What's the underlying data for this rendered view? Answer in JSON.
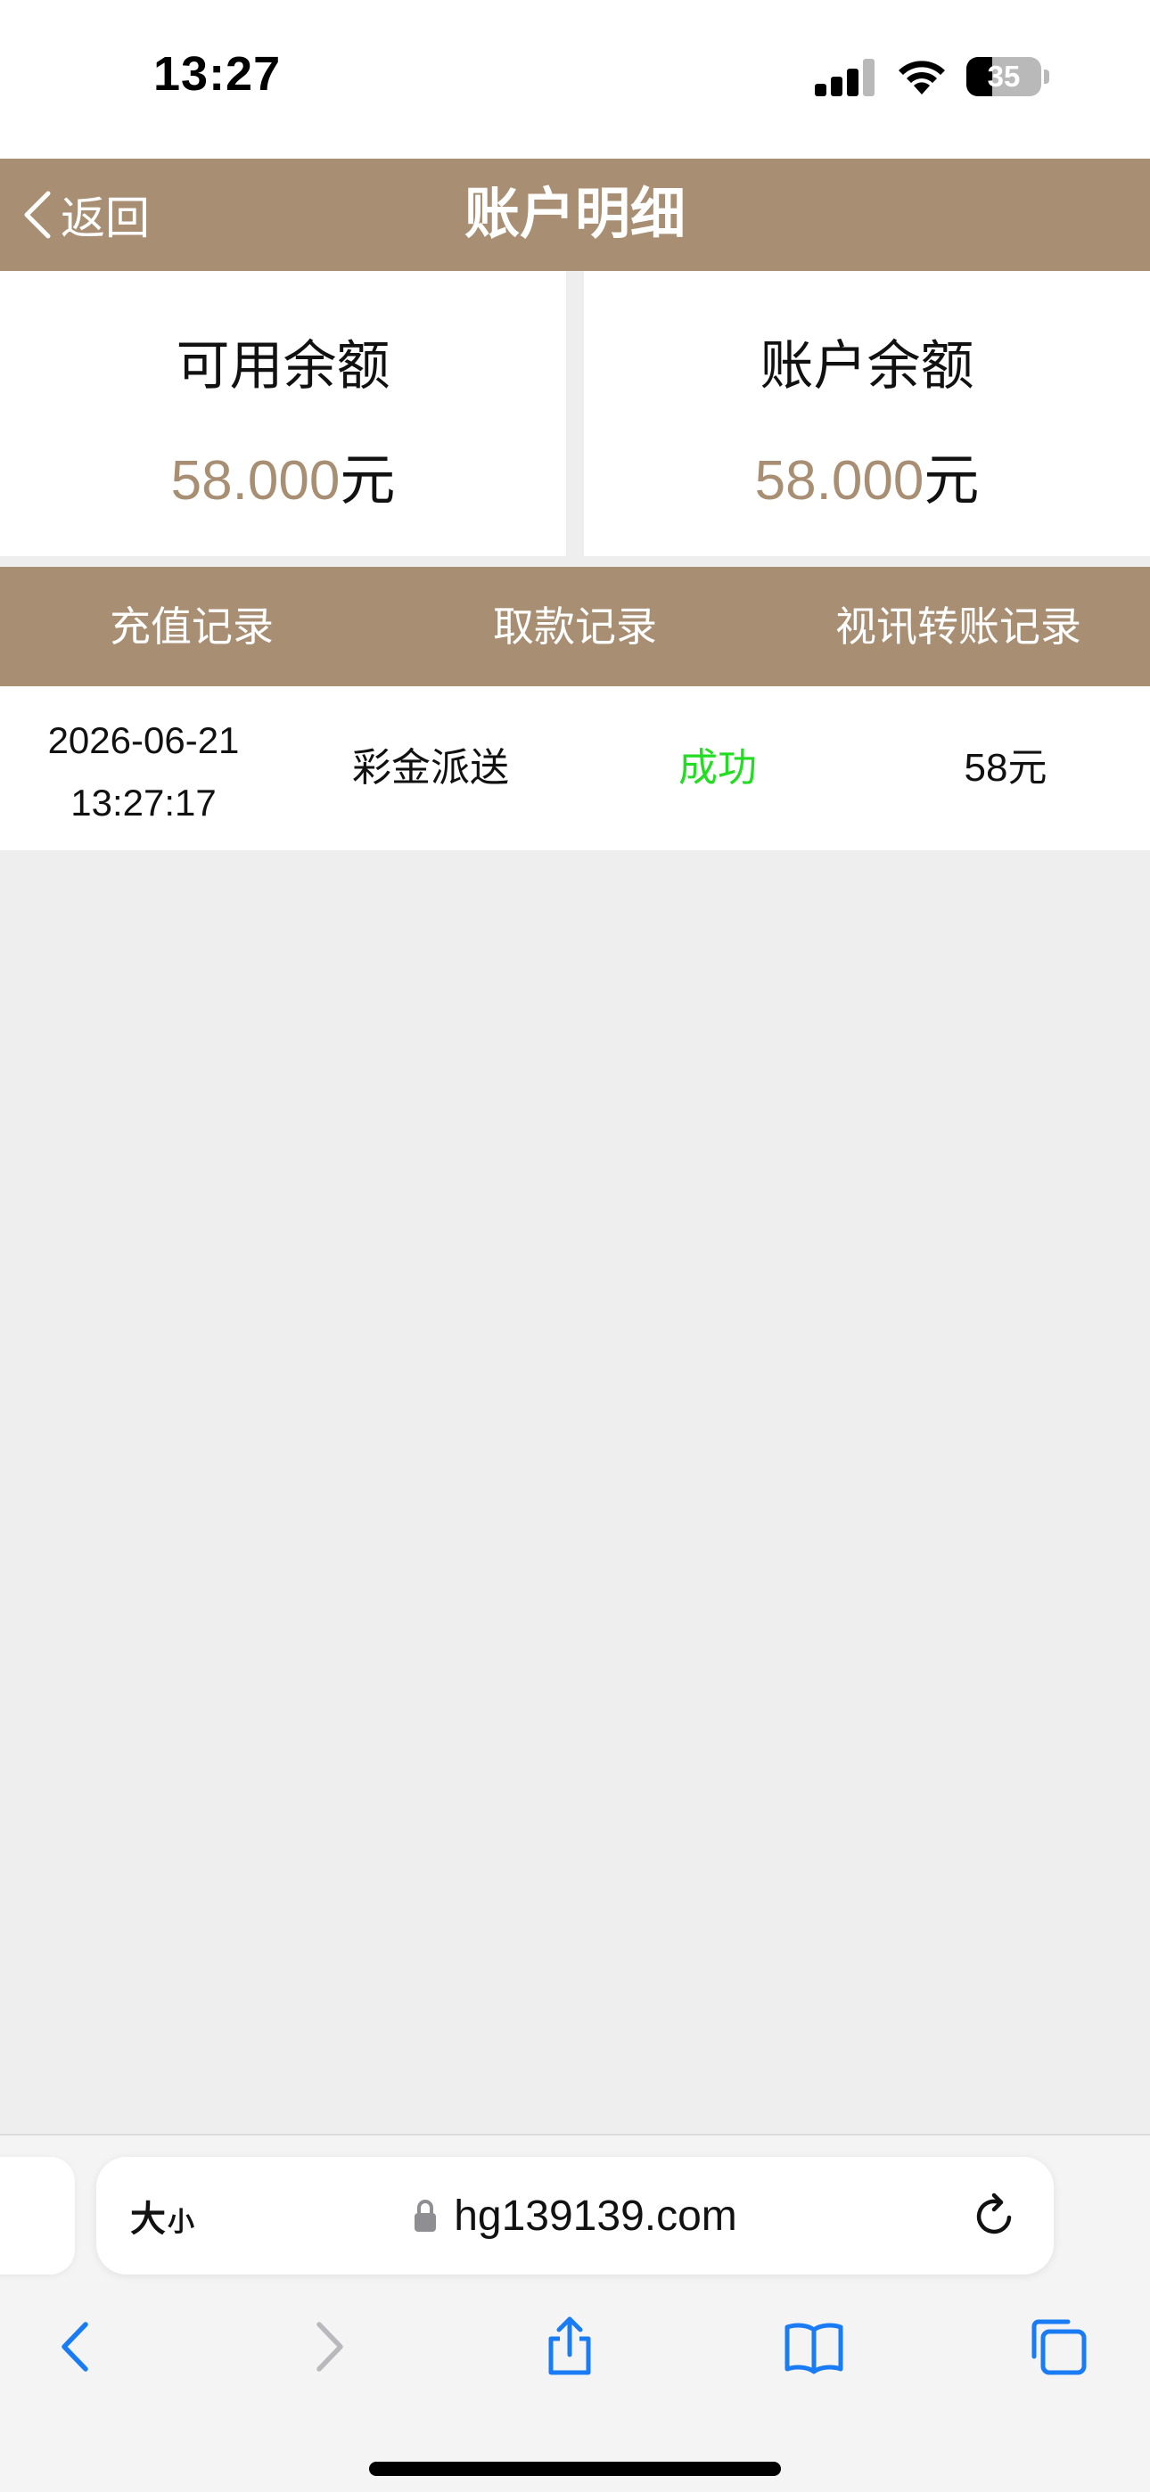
{
  "status_bar": {
    "time": "13:27",
    "battery_level": "35",
    "battery_fraction": 0.35
  },
  "header": {
    "back_label": "返回",
    "title": "账户明细"
  },
  "balances": {
    "available": {
      "label": "可用余额",
      "value": "58.000",
      "unit": "元"
    },
    "account": {
      "label": "账户余额",
      "value": "58.000",
      "unit": "元"
    }
  },
  "tabs": [
    {
      "label": "充值记录"
    },
    {
      "label": "取款记录"
    },
    {
      "label": "视讯转账记录"
    }
  ],
  "records": [
    {
      "date": "2026-06-21",
      "time": "13:27:17",
      "type": "彩金派送",
      "status": "成功",
      "amount": "58元"
    }
  ],
  "colors": {
    "accent": "#a88e72",
    "success": "#22dd22",
    "ios_blue": "#1a7cf5"
  },
  "browser": {
    "text_size_big": "大",
    "text_size_small": "小",
    "url": "hg139139.com",
    "icons": {
      "lock": "lock-icon",
      "reload": "reload-icon",
      "back": "chevron-left-icon",
      "forward": "chevron-right-icon",
      "share": "share-icon",
      "bookmarks": "book-icon",
      "tabs": "tabs-icon"
    }
  }
}
